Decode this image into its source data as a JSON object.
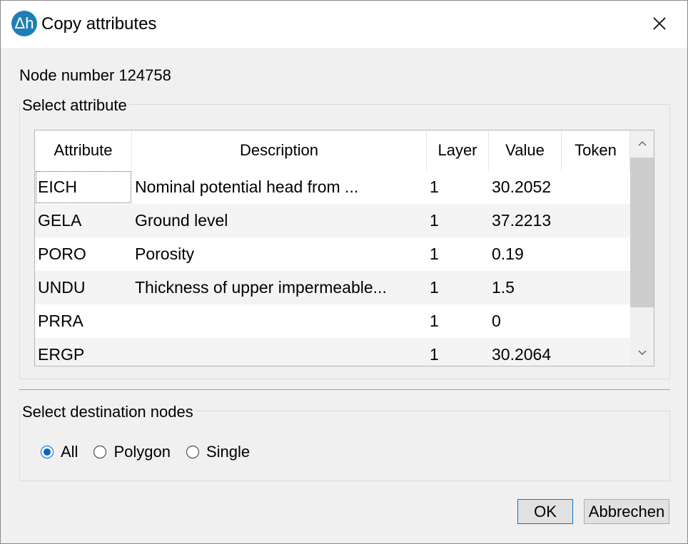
{
  "window": {
    "title": "Copy attributes",
    "logo_text": "Δh",
    "close_label": "✕"
  },
  "node_label": "Node number 124758",
  "attribute_group": {
    "label": "Select attribute",
    "columns": [
      "Attribute",
      "Description",
      "Layer",
      "Value",
      "Token"
    ],
    "rows": [
      {
        "attribute": "EICH",
        "description": "Nominal potential head from ...",
        "layer": "1",
        "value": "30.2052",
        "token": ""
      },
      {
        "attribute": "GELA",
        "description": "Ground level",
        "layer": "1",
        "value": "37.2213",
        "token": ""
      },
      {
        "attribute": "PORO",
        "description": "Porosity",
        "layer": "1",
        "value": "0.19",
        "token": ""
      },
      {
        "attribute": "UNDU",
        "description": "Thickness of upper impermeable...",
        "layer": "1",
        "value": "1.5",
        "token": ""
      },
      {
        "attribute": "PRRA",
        "description": "",
        "layer": "1",
        "value": "0",
        "token": ""
      },
      {
        "attribute": "ERGP",
        "description": "",
        "layer": "1",
        "value": "30.2064",
        "token": ""
      }
    ]
  },
  "destination_group": {
    "label": "Select destination nodes",
    "options": [
      "All",
      "Polygon",
      "Single"
    ],
    "selected": "All"
  },
  "buttons": {
    "ok": "OK",
    "cancel": "Abbrechen"
  },
  "colors": {
    "accent": "#0067c0",
    "logo": "#1f7fb5"
  }
}
